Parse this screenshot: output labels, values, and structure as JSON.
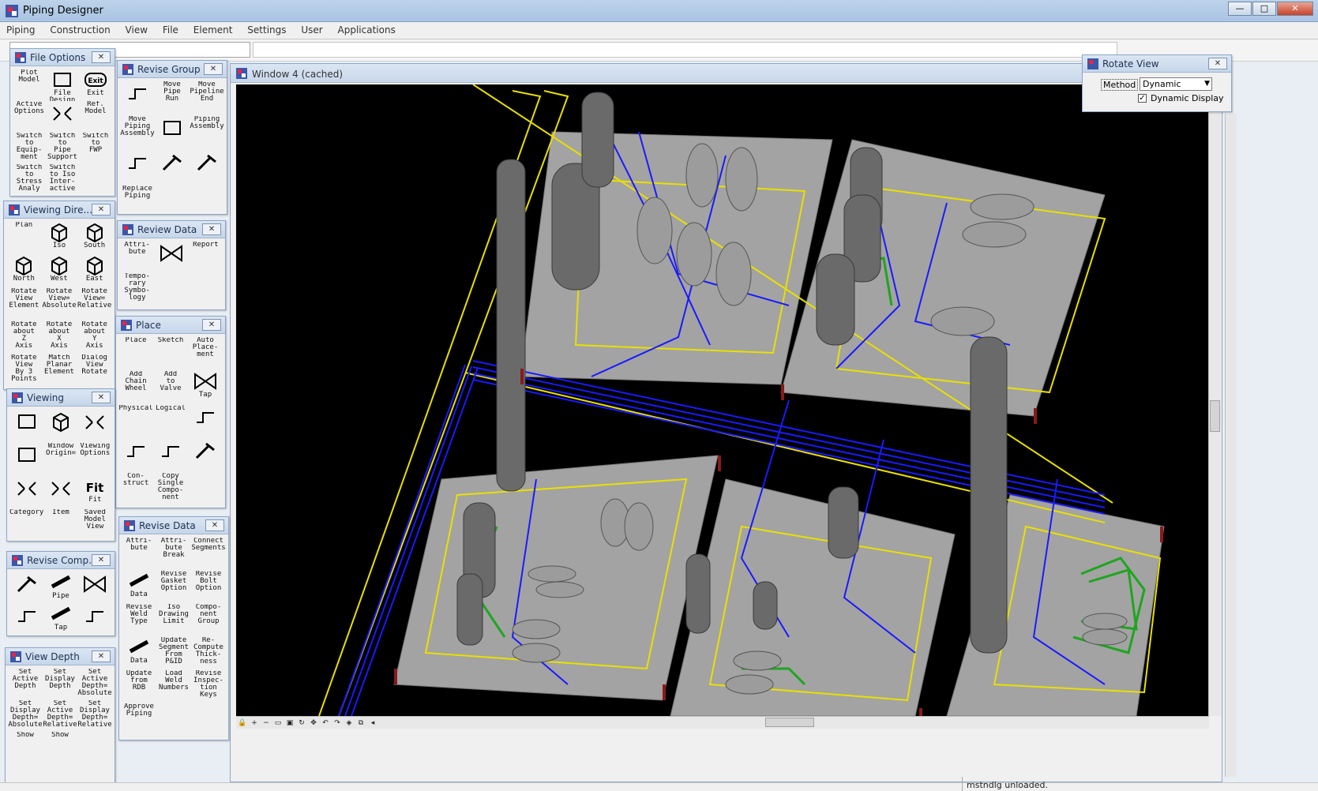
{
  "app": {
    "title": "Piping Designer",
    "window_buttons": {
      "minimize": "—",
      "maximize": "□",
      "close": "✕"
    }
  },
  "menu": [
    "Piping",
    "Construction",
    "View",
    "File",
    "Element",
    "Settings",
    "User",
    "Applications"
  ],
  "palettes": {
    "file_options": {
      "title": "File Options",
      "tools": [
        "Plot\nModel",
        "File\nDesign",
        "Exit",
        "Active\nOptions",
        "",
        "Ref.\nModel",
        "Switch\nto\nEquip-\nment",
        "Switch\nto\nPipe\nSupport",
        "Switch\nto\nFWP",
        "Switch\nto\nStress\nAnaly",
        "Switch\nto Iso\nInter-\nactive",
        ""
      ]
    },
    "revise_group": {
      "title": "Revise Group",
      "tools": [
        "",
        "Move\nPipe\nRun",
        "Move\nPipeline\nEnd",
        "Move\nPiping\nAssembly",
        "",
        "Piping\nAssembly",
        "",
        "",
        "",
        "Replace\nPiping",
        "",
        ""
      ]
    },
    "review_data": {
      "title": "Review Data",
      "tools": [
        "Attri-\nbute",
        "",
        "Report",
        "Tempo-\nrary\nSymbo-\nlogy",
        "",
        ""
      ]
    },
    "viewing_dire": {
      "title": "Viewing Dire...",
      "tools": [
        "Plan",
        "Iso",
        "South",
        "North",
        "West",
        "East",
        "Rotate\nView\nElement",
        "Rotate\nView=\nAbsolute",
        "Rotate\nView=\nRelative",
        "Rotate\nabout\nZ\nAxis",
        "Rotate\nabout\nX\nAxis",
        "Rotate\nabout\nY\nAxis",
        "Rotate\nView\nBy 3\nPoints",
        "Match\nPlanar\nElement",
        "Dialog\nView\nRotate"
      ]
    },
    "place": {
      "title": "Place",
      "tools": [
        "Place",
        "Sketch",
        "Auto\nPlace-\nment",
        "Add\nChain\nWheel",
        "Add\nto\nValve",
        "Tap",
        "Physical",
        "Logical",
        "",
        "",
        "",
        "",
        "Con-\nstruct",
        "Copy\nSingle\nCompo-\nnent",
        ""
      ]
    },
    "viewing": {
      "title": "Viewing",
      "tools": [
        "",
        "",
        "",
        "",
        "Window\nOrigin=",
        "Viewing\nOptions",
        "",
        "",
        "Fit",
        "Category",
        "Item",
        "Saved\nModel\nView"
      ]
    },
    "revise_data": {
      "title": "Revise Data",
      "tools": [
        "Attri-\nbute",
        "Attri-\nbute\nBreak",
        "Connect\nSegments",
        "Data",
        "Revise\nGasket\nOption",
        "Revise\nBolt\nOption",
        "Revise\nWeld\nType",
        "Iso\nDrawing\nLimit",
        "Compo-\nnent\nGroup",
        "Data",
        "Update\nSegment\nFrom\nP&ID",
        "Re-\nCompute\nThick-\nness",
        "Update\nfrom\nRDB",
        "Load\nWeld\nNumbers",
        "Revise\nInspec-\ntion\nKeys",
        "Approve\nPiping",
        "",
        ""
      ]
    },
    "revise_comp": {
      "title": "Revise Comp...",
      "tools": [
        "",
        "Pipe",
        "",
        "",
        "Tap",
        ""
      ]
    },
    "view_depth": {
      "title": "View Depth",
      "tools": [
        "Set\nActive\nDepth",
        "Set\nDisplay\nDepth",
        "Set\nActive\nDepth=\nAbsolute",
        "Set\nDisplay\nDepth=\nAbsolute",
        "Set\nActive\nDepth=\nRelative",
        "Set\nDisplay\nDepth=\nRelative",
        "Show",
        "Show",
        ""
      ]
    },
    "rotate_view": {
      "title": "Rotate View",
      "method_label": "Method",
      "method_value": "Dynamic",
      "dynamic_display_label": "Dynamic Display",
      "dynamic_display_checked": true
    }
  },
  "drawing_window": {
    "title": "Window 4 (cached)"
  },
  "status": {
    "message": "mstndlg unloaded."
  },
  "colors": {
    "pipe_blue": "#1a1aff",
    "pipe_green": "#1fa51f",
    "steel_yellow": "#e8e000",
    "deck_gray": "#a3a3a3",
    "column_red": "#8a1a1a"
  }
}
